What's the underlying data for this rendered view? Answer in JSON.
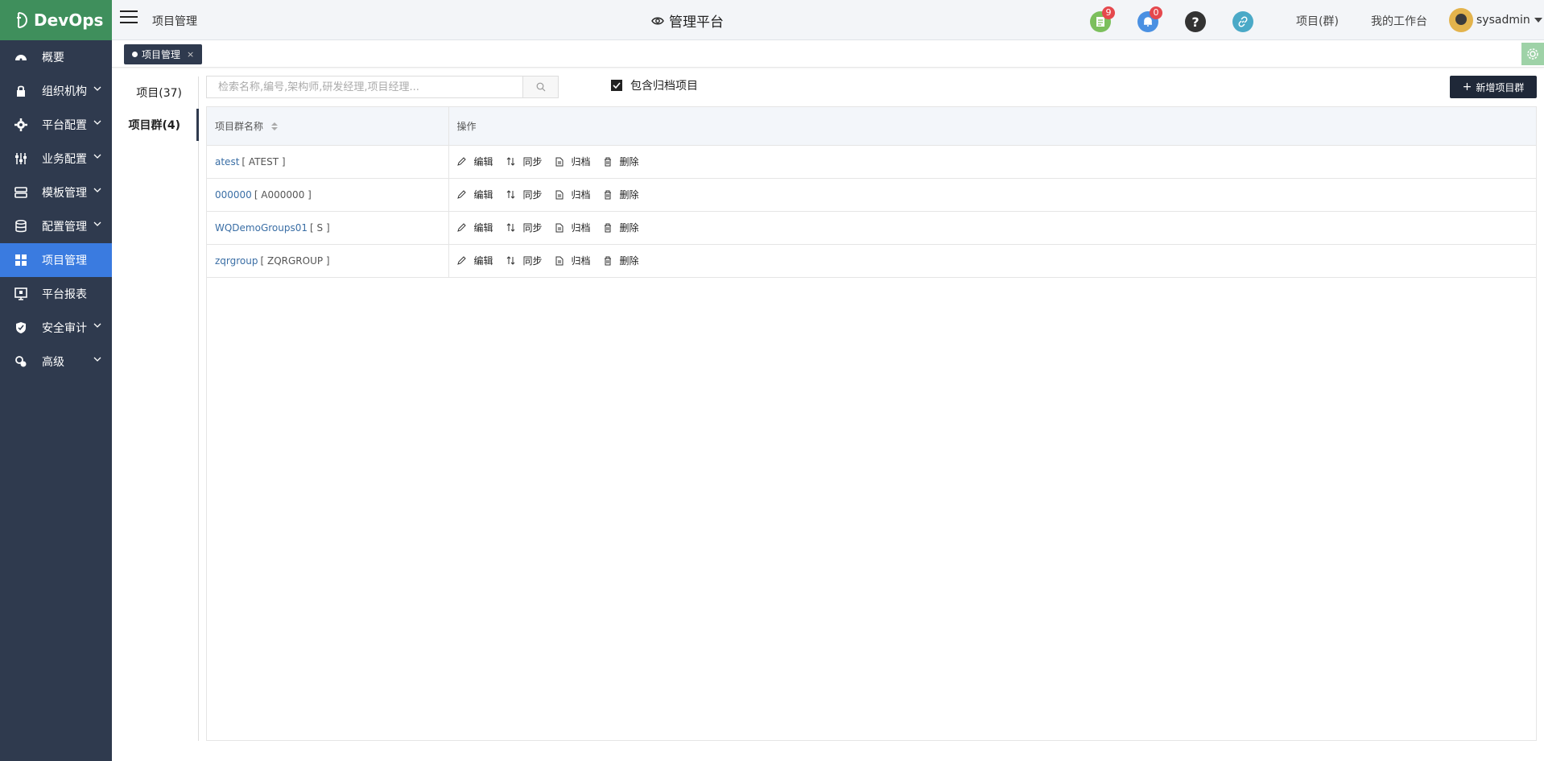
{
  "brand": {
    "name": "DevOps"
  },
  "sidebar": {
    "items": [
      {
        "label": "概要",
        "icon": "dashboard-icon",
        "has_chevron": false
      },
      {
        "label": "组织机构",
        "icon": "lock-icon",
        "has_chevron": true
      },
      {
        "label": "平台配置",
        "icon": "gear-icon",
        "has_chevron": true
      },
      {
        "label": "业务配置",
        "icon": "sliders-icon",
        "has_chevron": true
      },
      {
        "label": "模板管理",
        "icon": "template-icon",
        "has_chevron": true
      },
      {
        "label": "配置管理",
        "icon": "database-icon",
        "has_chevron": true
      },
      {
        "label": "项目管理",
        "icon": "grid-icon",
        "has_chevron": false,
        "active": true
      },
      {
        "label": "平台报表",
        "icon": "report-icon",
        "has_chevron": false
      },
      {
        "label": "安全审计",
        "icon": "shield-icon",
        "has_chevron": true
      },
      {
        "label": "高级",
        "icon": "advanced-icon",
        "has_chevron": true
      }
    ]
  },
  "header": {
    "breadcrumb": "项目管理",
    "title": "管理平台",
    "notifications": [
      {
        "icon": "document-icon",
        "count": "9",
        "color": "#7cbf5c"
      },
      {
        "icon": "bell-icon",
        "count": "0",
        "color": "#4a90e2"
      }
    ],
    "help_icon": "help-icon",
    "link_icon": "link-icon",
    "links": [
      "项目(群)",
      "我的工作台"
    ],
    "user": "sysadmin"
  },
  "tabs": {
    "active_tab": "项目管理",
    "close": "×"
  },
  "subnav": {
    "items": [
      {
        "label": "项目(37)",
        "active": false
      },
      {
        "label": "项目群(4)",
        "active": true
      }
    ]
  },
  "toolbar": {
    "search_placeholder": "检索名称,编号,架构师,研发经理,项目经理...",
    "include_archived_label": "包含归档项目",
    "include_archived_checked": true,
    "add_button": "新增项目群"
  },
  "table": {
    "headers": [
      "项目群名称",
      "操作"
    ],
    "actions": [
      "编辑",
      "同步",
      "归档",
      "删除"
    ],
    "rows": [
      {
        "name": "atest",
        "code": "[ ATEST ]"
      },
      {
        "name": "000000",
        "code": "[ A000000 ]"
      },
      {
        "name": "WQDemoGroups01",
        "code": "[ S ]"
      },
      {
        "name": "zqrgroup",
        "code": "[ ZQRGROUP ]"
      }
    ]
  }
}
